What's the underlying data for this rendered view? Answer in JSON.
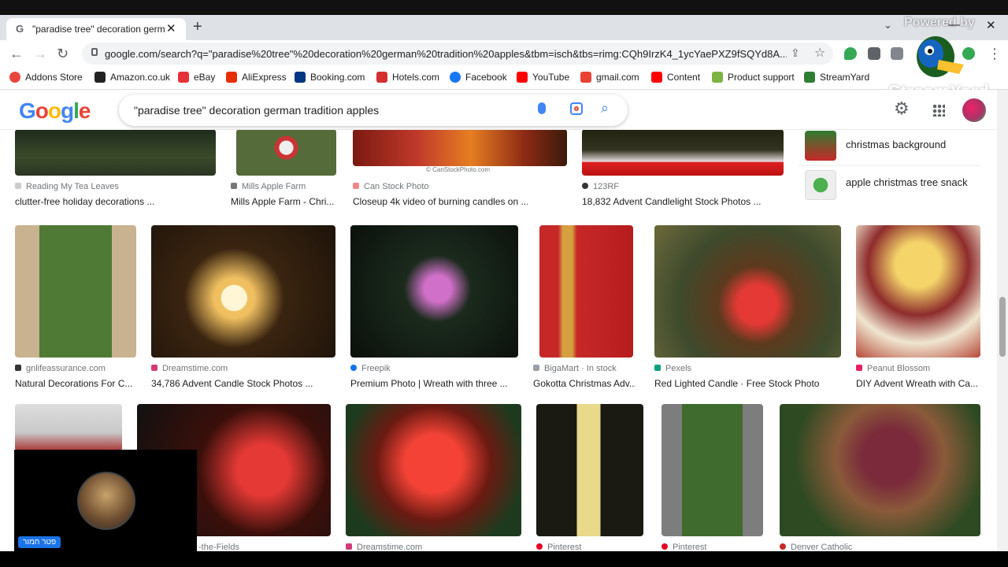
{
  "browser": {
    "tab_title": "\"paradise tree\" decoration germ",
    "url": "google.com/search?q=\"paradise%20tree\"%20decoration%20german%20tradition%20apples&tbm=isch&tbs=rimg:CQh9IrzK4_1ycYaePXZ9fSQYd8A...",
    "overlay_text": "Powered by",
    "bookmarks": [
      "Addons Store",
      "Amazon.co.uk",
      "eBay",
      "AliExpress",
      "Booking.com",
      "Hotels.com",
      "Facebook",
      "YouTube",
      "gmail.com",
      "Content",
      "Product support",
      "StreamYard"
    ]
  },
  "streamyard_watermark": "StreamYard",
  "google": {
    "logo_letters": [
      "G",
      "o",
      "o",
      "g",
      "l",
      "e"
    ],
    "query": "\"paradise tree\" decoration german tradition apples"
  },
  "related_searches": [
    {
      "label": "christmas background"
    },
    {
      "label": "apple christmas tree snack"
    }
  ],
  "results_row1": [
    {
      "source": "Reading My Tea Leaves",
      "caption": "clutter-free holiday decorations ..."
    },
    {
      "source": "Mills Apple Farm",
      "caption": "Mills Apple Farm - Chri..."
    },
    {
      "source": "Can Stock Photo",
      "caption": "Closeup 4k video of burning candles on ..."
    },
    {
      "source": "123RF",
      "caption": "18,832 Advent Candlelight Stock Photos ..."
    }
  ],
  "results_row2": [
    {
      "source": "gnlifeassurance.com",
      "caption": "Natural Decorations For C..."
    },
    {
      "source": "Dreamstime.com",
      "caption": "34,786 Advent Candle Stock Photos ..."
    },
    {
      "source": "Freepik",
      "caption": "Premium Photo | Wreath with three ..."
    },
    {
      "source": "BigaMart · In stock",
      "caption": "Gokotta Christmas Adv..."
    },
    {
      "source": "Pexels",
      "caption": "Red Lighted Candle · Free Stock Photo"
    },
    {
      "source": "Peanut Blossom",
      "caption": "DIY Advent Wreath with Ca..."
    }
  ],
  "results_row3": [
    {
      "source": "-the-Fields"
    },
    {
      "source": "Dreamstime.com"
    },
    {
      "source": "Pinterest"
    },
    {
      "source": "Pinterest"
    },
    {
      "source": "Denver Catholic"
    }
  ],
  "image_watermark": "© CanStockPhoto.com",
  "camera": {
    "name": "פטר חמור"
  }
}
